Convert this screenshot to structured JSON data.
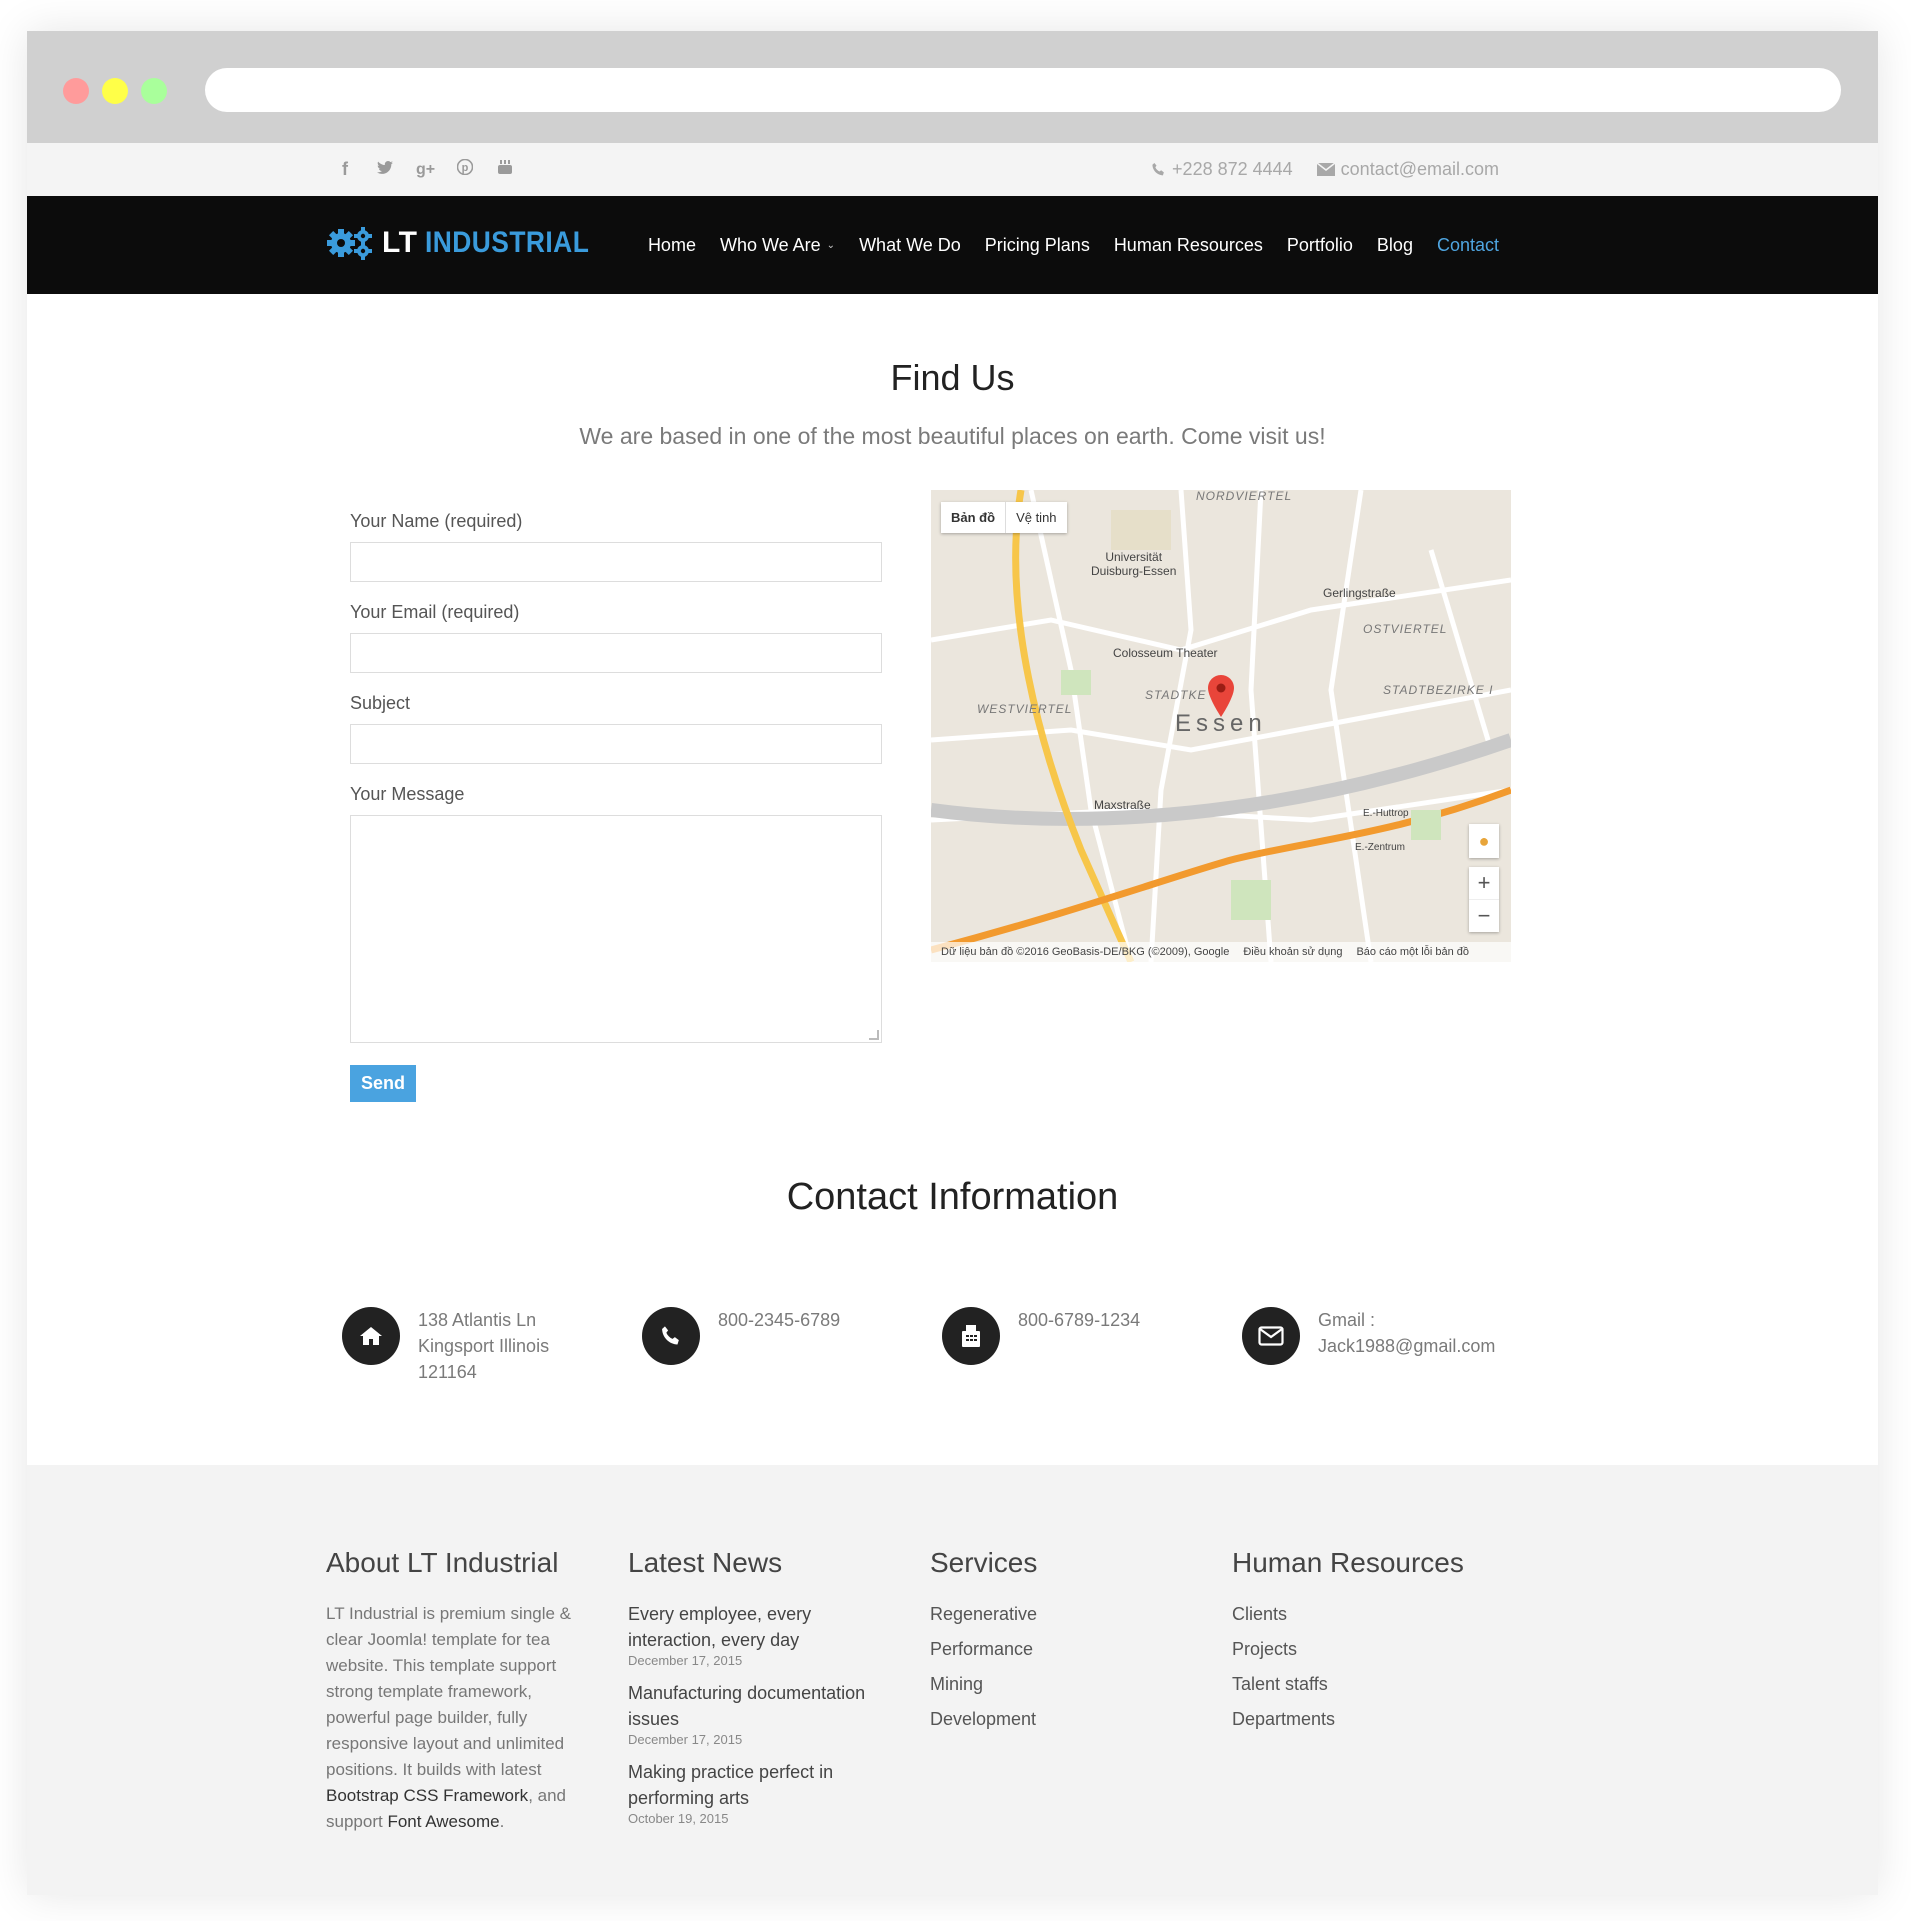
{
  "browser": {
    "url": ""
  },
  "topbar": {
    "social": [
      "facebook-icon",
      "twitter-icon",
      "google-plus-icon",
      "pinterest-icon",
      "youtube-icon"
    ],
    "phone": "+228 872 4444",
    "email": "contact@email.com"
  },
  "nav": {
    "logo_lt": "LT",
    "logo_industrial": "INDUSTRIAL",
    "items": [
      {
        "label": "Home"
      },
      {
        "label": "Who We Are"
      },
      {
        "label": "What We Do"
      },
      {
        "label": "Pricing Plans"
      },
      {
        "label": "Human Resources"
      },
      {
        "label": "Portfolio"
      },
      {
        "label": "Blog"
      },
      {
        "label": "Contact"
      }
    ],
    "active_color": "#4fa5e0"
  },
  "find": {
    "title": "Find Us",
    "subtitle": "We are based in one of the most beautiful places on earth. Come visit us!"
  },
  "form": {
    "name_label": "Your Name (required)",
    "email_label": "Your Email (required)",
    "subject_label": "Subject",
    "message_label": "Your Message",
    "send_label": "Send"
  },
  "map": {
    "tab_map": "Bản đồ",
    "tab_sat": "Vệ tinh",
    "city": "Essen",
    "labels": {
      "nordviertel": "NORDVIERTEL",
      "university": "Universität\nDuisburg-Essen",
      "gerling": "Gerlingstraße",
      "ostviertel": "OSTVIERTEL",
      "colosseum": "Colosseum Theater",
      "westviertel": "WESTVIERTEL",
      "stadtke": "STADTKE",
      "stadtbezirke": "STADTBEZIRKE I",
      "maxstrasse": "Maxstraße",
      "huttrop": "E.-Huttrop",
      "zentrum": "E.-Zentrum"
    },
    "attribution": "Dữ liệu bản đồ ©2016 GeoBasis-DE/BKG (©2009), Google",
    "terms": "Điều khoản sử dụng",
    "report": "Báo cáo một lỗi bản đồ"
  },
  "contact": {
    "title": "Contact Information",
    "items": [
      {
        "icon": "home-icon",
        "text": "138 Atlantis Ln\nKingsport Illinois\n121164"
      },
      {
        "icon": "phone-icon",
        "text": "800-2345-6789"
      },
      {
        "icon": "fax-icon",
        "text": "800-6789-1234"
      },
      {
        "icon": "envelope-icon",
        "text": "Gmail :\nJack1988@gmail.com"
      }
    ]
  },
  "footer": {
    "about_title": "About LT Industrial",
    "about_text_1": "LT Industrial is premium single & clear Joomla! template for tea website. This template support strong template framework, powerful page builder, fully responsive layout and unlimited positions. It builds with latest",
    "about_link_1": "Bootstrap CSS Framework",
    "about_text_2": ", and support",
    "about_link_2": "Font Awesome",
    "about_text_3": ".",
    "news_title": "Latest News",
    "news": [
      {
        "title": "Every employee, every interaction, every day",
        "date": "December 17, 2015"
      },
      {
        "title": "Manufacturing documentation issues",
        "date": "December 17, 2015"
      },
      {
        "title": "Making practice perfect in performing arts",
        "date": "October 19, 2015"
      }
    ],
    "services_title": "Services",
    "services": [
      "Regenerative",
      "Performance",
      "Mining",
      "Development"
    ],
    "hr_title": "Human Resources",
    "hr": [
      "Clients",
      "Projects",
      "Talent staffs",
      "Departments"
    ]
  }
}
